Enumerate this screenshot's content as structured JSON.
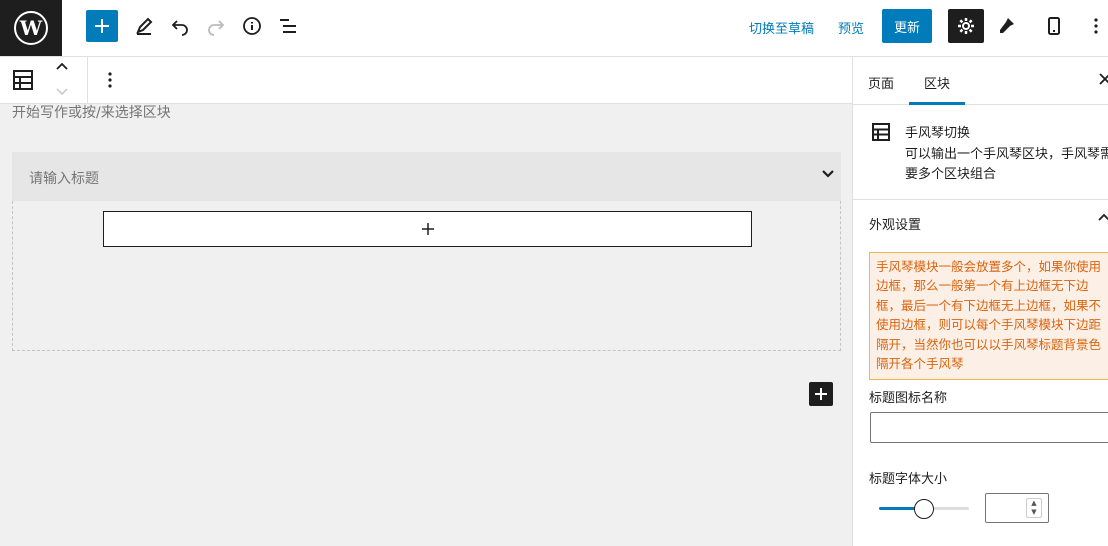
{
  "topbar": {
    "switch_draft": "切换至草稿",
    "preview": "预览",
    "update": "更新"
  },
  "canvas": {
    "placeholder": "开始写作或按/来选择区块",
    "accordion_title_placeholder": "请输入标题"
  },
  "sidebar": {
    "tabs": [
      "页面",
      "区块"
    ],
    "active_tab": "区块",
    "block_name": "手风琴切换",
    "block_desc": "可以输出一个手风琴区块，手风琴需要多个区块组合",
    "panel_title": "外观设置",
    "notice": "手风琴模块一般会放置多个，如果你使用边框，那么一般第一个有上边框无下边框，最后一个有下边框无上边框，如果不使用边框，则可以每个手风琴模块下边距隔开，当然你也可以以手风琴标题背景色隔开各个手风琴",
    "field_icon_label": "标题图标名称",
    "field_font_label": "标题字体大小",
    "slider_fraction": 0.5
  },
  "colors": {
    "accent": "#007cba",
    "dark": "#1e1e1e",
    "notice_text": "#d9630f",
    "notice_bg": "#fcf0e6"
  },
  "icons": [
    "wordpress-logo-icon",
    "plus-icon",
    "pencil-icon",
    "undo-icon",
    "redo-icon",
    "info-icon",
    "list-view-icon",
    "gear-icon",
    "brush-icon",
    "mobile-icon",
    "more-vertical-icon",
    "block-icon",
    "chevron-up-icon",
    "chevron-down-icon",
    "close-icon"
  ]
}
